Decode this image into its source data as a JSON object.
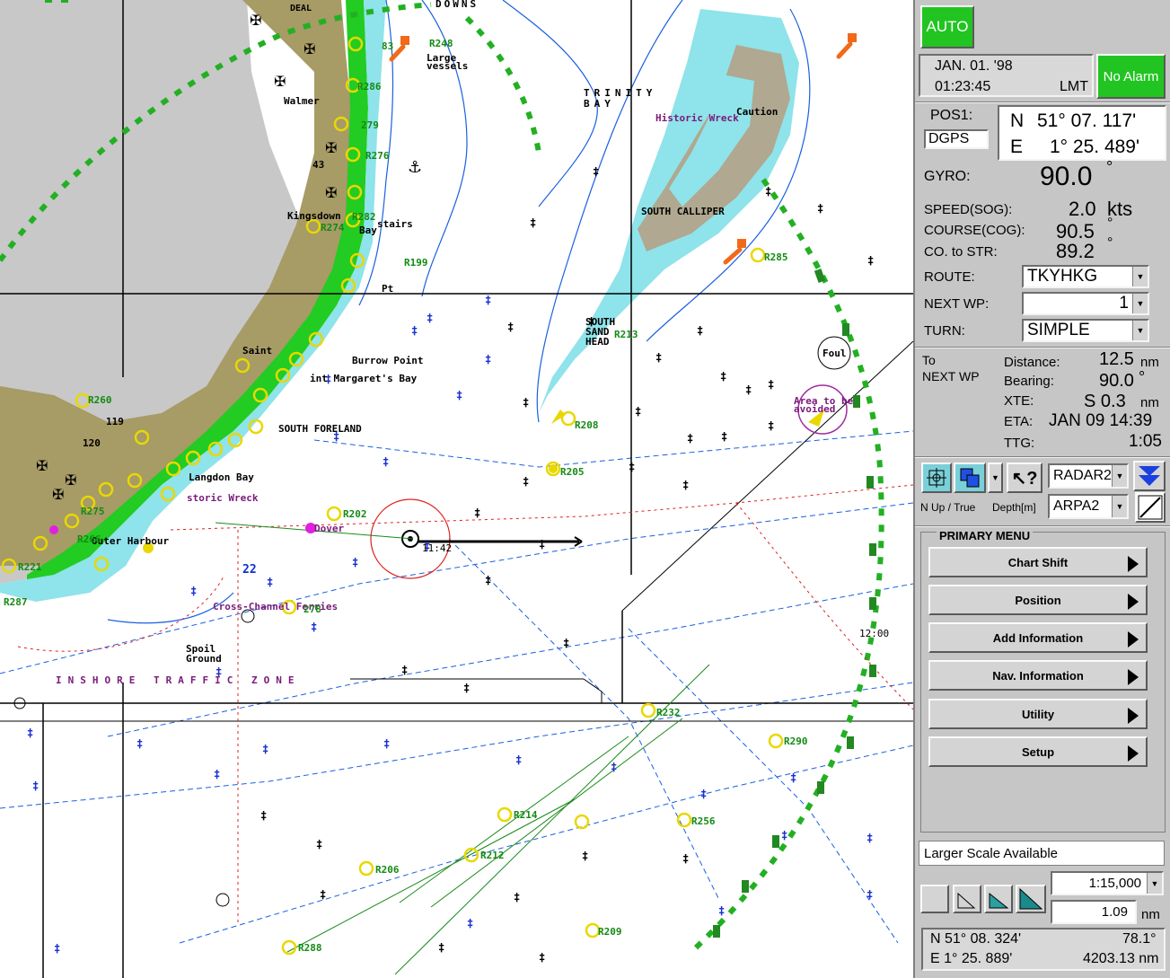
{
  "chart": {
    "labels": {
      "deal": "DEAL",
      "downs": "DOWNS",
      "large_vessels": "Large\nvessels",
      "trinity_bay": "TRINITY\nBAY",
      "walmer": "Walmer",
      "kingsdown": "Kingsdown",
      "stairs": "stairs",
      "bay": "Bay",
      "south_calliper": "SOUTH  CALLIPER",
      "historic_wreck": "Historic Wreck",
      "caution": "Caution",
      "south_sand_head": "SOUTH\nSAND\nHEAD",
      "saint": "Saint",
      "burrow_point": "Burrow Point",
      "st_margarets_bay": "int Margaret's Bay",
      "south_foreland": "SOUTH FORELAND",
      "langdon_bay": "Langdon Bay",
      "historic_wreck2": "storic Wreck",
      "dover": "Dover",
      "outer_harbour": "Outer Harbour",
      "cross_channel_ferries": "Cross-Channel Ferries",
      "spoil_ground": "Spoil\nGround",
      "inshore_traffic_zone": "INSHORE TRAFFIC ZONE",
      "area_avoided": "Area to be\navoided",
      "foul": "Foul",
      "depth_22": "22",
      "depth_119": "119",
      "depth_120": "120",
      "depth_43": "43",
      "time_1142": "11:42",
      "time_1200": "12:00",
      "pt": "Pt",
      "r248": "R248",
      "r283": "83",
      "r286": "R286",
      "r279": "279",
      "r276": "R276",
      "r282": "R282",
      "r274": "R274",
      "r199": "R199",
      "r285": "R285",
      "r213": "R213",
      "r208": "R208",
      "r205": "R205",
      "r202": "R202",
      "r260": "R260",
      "r232": "R232",
      "r290": "R290",
      "r214": "R214",
      "r256": "R256",
      "r212": "R212",
      "r206": "R206",
      "r209": "R209",
      "r288": "R288",
      "r278": "278",
      "r275": "R275",
      "r266": "R266",
      "r221": "R221",
      "r287": "R287"
    }
  },
  "panel": {
    "auto_label": "AUTO",
    "date": "JAN. 01. '98",
    "time": "01:23:45",
    "time_zone": "LMT",
    "alarm_label": "No Alarm",
    "pos_label": "POS1:",
    "pos_source": "DGPS",
    "lat_hemi": "N",
    "lat_value": "51°  07. 117'",
    "lon_hemi": "E",
    "lon_value": "1°  25. 489'",
    "gyro_label": "GYRO:",
    "gyro_value": "90.0",
    "gyro_unit": "°",
    "speed_label": "SPEED(SOG):",
    "speed_value": "2.0",
    "speed_unit": "kts",
    "course_label": "COURSE(COG):",
    "course_value": "90.5",
    "course_unit": "°",
    "costr_label": "CO. to STR:",
    "costr_value": "89.2",
    "costr_unit": "°",
    "route_label": "ROUTE:",
    "route_value": "TKYHKG",
    "nextwp_label": "NEXT WP:",
    "nextwp_value": "1",
    "turn_label": "TURN:",
    "turn_value": "SIMPLE",
    "to_label": "To\nNEXT WP",
    "distance_label": "Distance:",
    "distance_value": "12.5",
    "distance_unit": "nm",
    "bearing_label": "Bearing:",
    "bearing_value": "90.0",
    "bearing_unit": "°",
    "xte_label": "XTE:",
    "xte_value": "S  0.3",
    "xte_unit": "nm",
    "eta_label": "ETA:",
    "eta_value": "JAN 09 14:39",
    "ttg_label": "TTG:",
    "ttg_value": "1:05",
    "nup_label": "N Up / True",
    "depth_label": "Depth[m]",
    "radar_value": "RADAR2",
    "arpa_value": "ARPA2",
    "menu_title": "PRIMARY MENU",
    "menu_items": [
      "Chart Shift",
      "Position",
      "Add Information",
      "Nav. Information",
      "Utility",
      "Setup"
    ],
    "status_message": "Larger Scale Available",
    "scale_value": "1:15,000",
    "range_value": "1.09",
    "range_unit": "nm",
    "cursor_lat": "N   51°  08. 324'",
    "cursor_bearing": "78.1°",
    "cursor_lon": "E    1°  25. 889'",
    "cursor_dist": "4203.13 nm"
  }
}
